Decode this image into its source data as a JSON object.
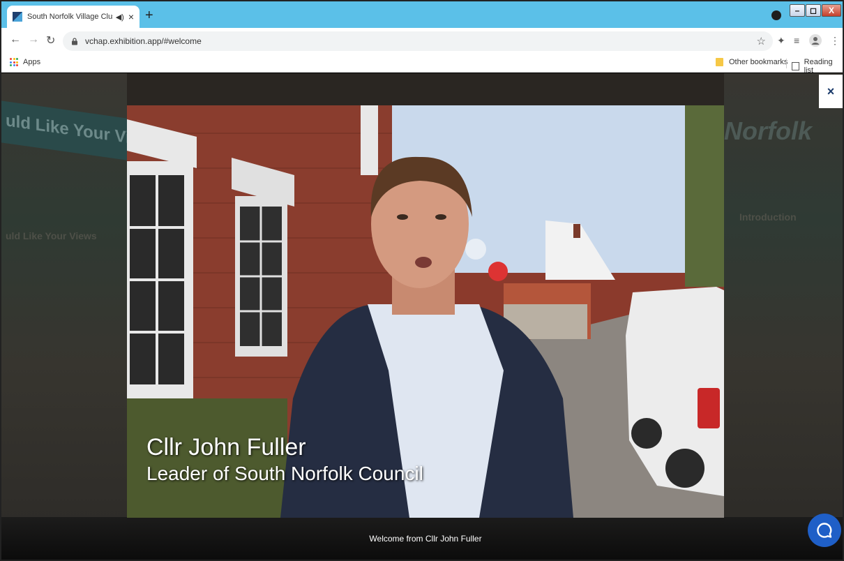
{
  "browser": {
    "tab": {
      "title": "South Norfolk Village Cluste",
      "close": "×"
    },
    "new_tab": "+",
    "url": "vchap.exhibition.app/#welcome",
    "bookmarks": {
      "apps": "Apps",
      "other": "Other bookmarks",
      "reading_list": "Reading list"
    },
    "window_controls": {
      "minimize": "–",
      "maximize": "◻",
      "close": "X"
    }
  },
  "page": {
    "background_left_banner": "uld Like Your Vie",
    "background_left_text": "uld Like Your Views",
    "background_right_logo": "Norfolk",
    "background_right_text": "Introduction",
    "close_label": "×",
    "video": {
      "lower_third_name": "Cllr John Fuller",
      "lower_third_role": "Leader of South Norfolk Council",
      "caption": "Welcome from Cllr John Fuller"
    }
  },
  "colors": {
    "tabstrip": "#5bc0e8",
    "chat_button": "#1f5fc7",
    "close_x": "#1a3a6a"
  }
}
